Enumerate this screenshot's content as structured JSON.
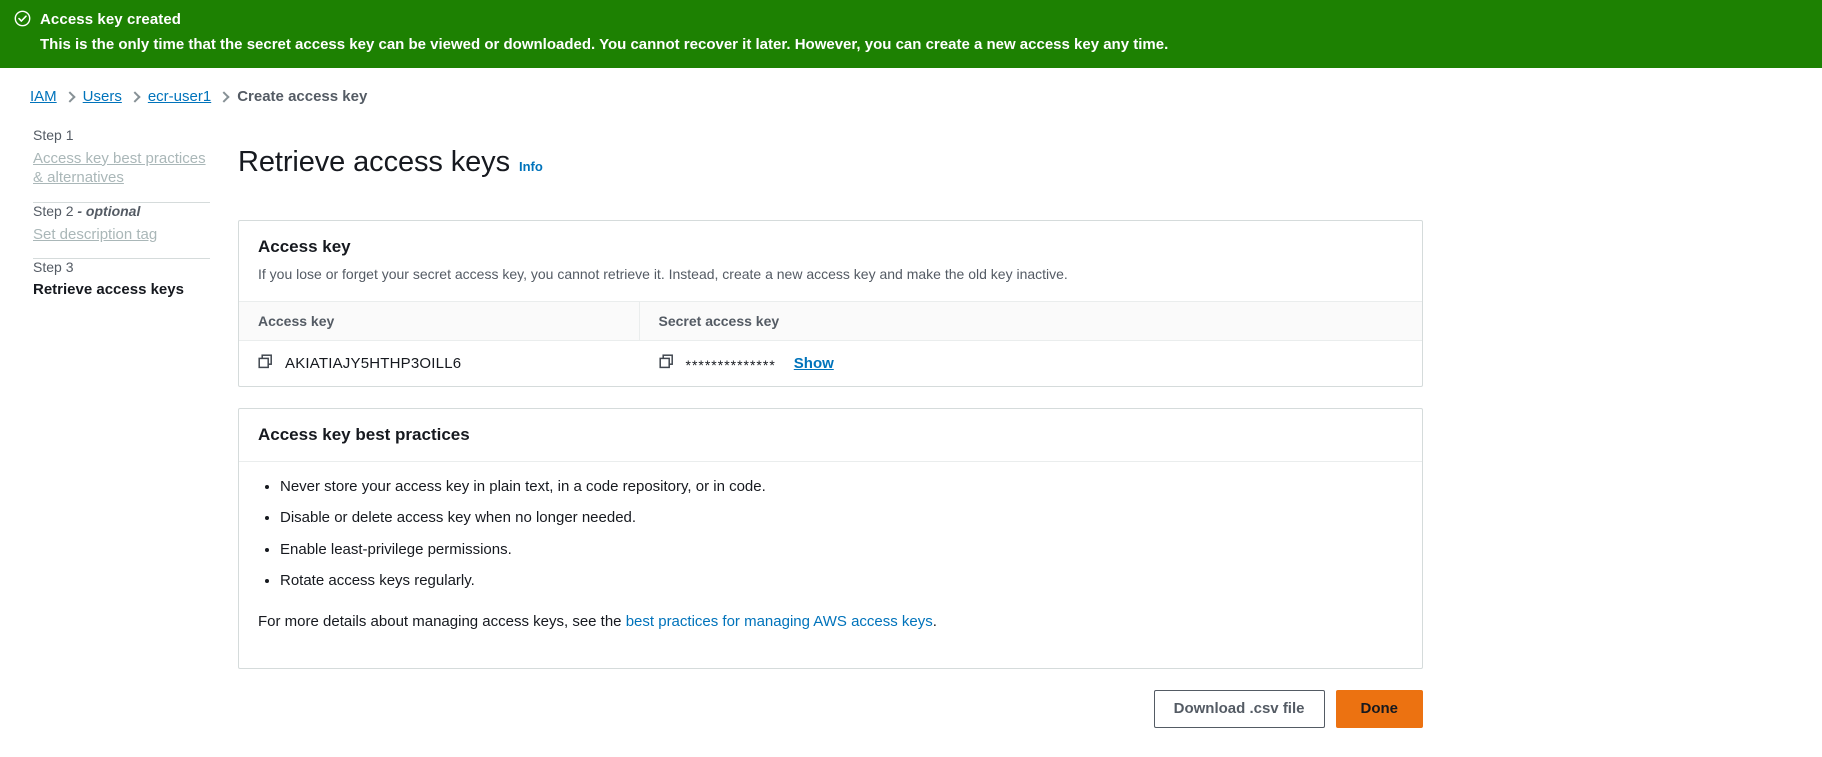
{
  "banner": {
    "icon": "check-circle-icon",
    "title": "Access key created",
    "message": "This is the only time that the secret access key can be viewed or downloaded. You cannot recover it later. However, you can create a new access key any time.",
    "background_color": "#1d8102"
  },
  "breadcrumb": {
    "items": [
      {
        "label": "IAM",
        "is_link": true
      },
      {
        "label": "Users",
        "is_link": true
      },
      {
        "label": "ecr-user1",
        "is_link": true
      },
      {
        "label": "Create access key",
        "is_link": false
      }
    ],
    "separator_icon": "chevron-right-icon"
  },
  "wizard": {
    "steps": [
      {
        "label": "Step 1",
        "optional_suffix": "",
        "name": "Access key best practices & alternatives",
        "state": "completed"
      },
      {
        "label": "Step 2",
        "optional_suffix": " - optional",
        "name": "Set description tag",
        "state": "completed"
      },
      {
        "label": "Step 3",
        "optional_suffix": "",
        "name": "Retrieve access keys",
        "state": "active"
      }
    ]
  },
  "main": {
    "title": "Retrieve access keys",
    "info_link": "Info"
  },
  "access_key_card": {
    "title": "Access key",
    "description": "If you lose or forget your secret access key, you cannot retrieve it. Instead, create a new access key and make the old key inactive.",
    "columns": [
      {
        "header": "Access key"
      },
      {
        "header": "Secret access key"
      }
    ],
    "row": {
      "access_key": "AKIATIAJY5HTHP3OILL6",
      "access_key_copy_icon": "copy-icon",
      "secret_access_key_masked": "**************",
      "secret_key_copy_icon": "copy-icon",
      "show_label": "Show"
    }
  },
  "best_practices_card": {
    "title": "Access key best practices",
    "items": [
      "Never store your access key in plain text, in a code repository, or in code.",
      "Disable or delete access key when no longer needed.",
      "Enable least-privilege permissions.",
      "Rotate access keys regularly."
    ],
    "note_prefix": "For more details about managing access keys, see the ",
    "note_link": "best practices for managing AWS access keys",
    "note_suffix": "."
  },
  "footer": {
    "download_label": "Download .csv file",
    "done_label": "Done",
    "primary_color": "#ec7211"
  }
}
